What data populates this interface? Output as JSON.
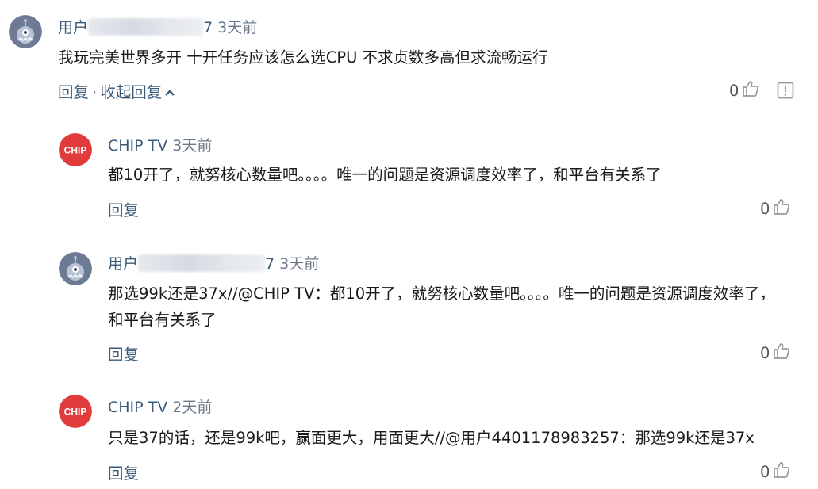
{
  "comments": [
    {
      "author_prefix": "用户",
      "author_suffix": "7",
      "time": "3天前",
      "content": "我玩完美世界多开 十开任务应该怎么选CPU 不求贞数多高但求流畅运行",
      "reply_label": "回复",
      "separator": "·",
      "collapse_label": "收起回复",
      "like_count": "0"
    },
    {
      "author": "CHIP TV",
      "time": "3天前",
      "content": "都10开了，就努核心数量吧。。。。唯一的问题是资源调度效率了，和平台有关系了",
      "reply_label": "回复",
      "like_count": "0"
    },
    {
      "author_prefix": "用户",
      "author_suffix": "7",
      "time": "3天前",
      "content": "那选99k还是37x//@CHIP TV：都10开了，就努核心数量吧。。。。唯一的问题是资源调度效率了，和平台有关系了",
      "reply_label": "回复",
      "like_count": "0"
    },
    {
      "author": "CHIP TV",
      "time": "2天前",
      "content": "只是37的话，还是99k吧，赢面更大，用面更大//@用户4401178983257：那选99k还是37x",
      "reply_label": "回复",
      "like_count": "0"
    }
  ],
  "chip_logo_text": "CHIP",
  "colors": {
    "link": "#3a5a7a",
    "chip_red": "#e23b3b",
    "avatar_bg": "#6d7a93"
  }
}
